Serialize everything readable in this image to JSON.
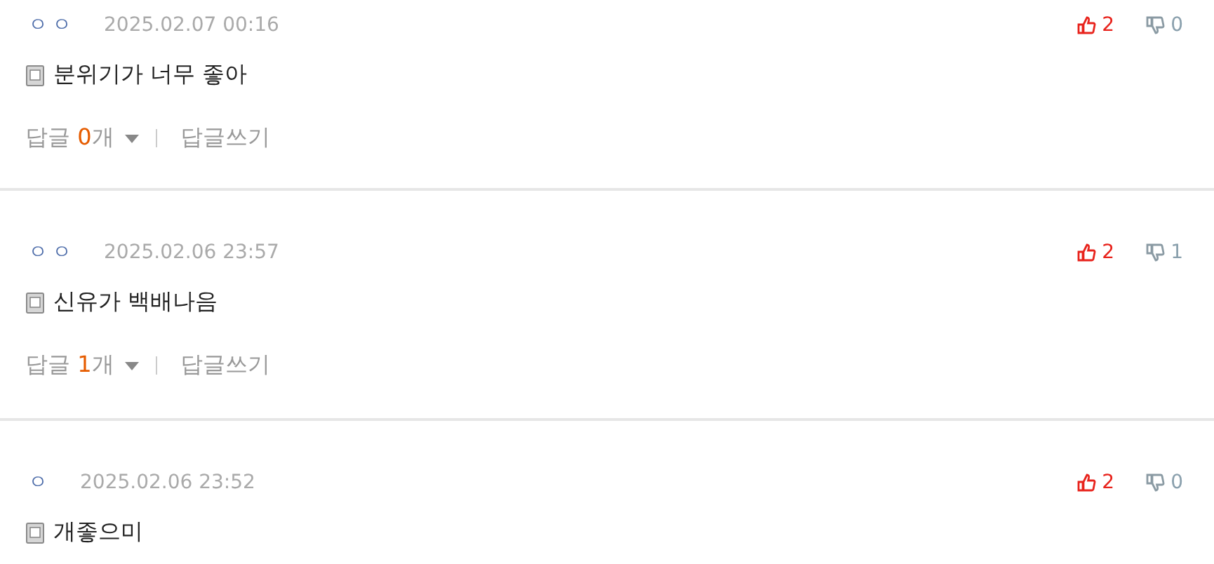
{
  "comments": [
    {
      "author": "ㅇㅇ",
      "date": "2025.02.07 00:16",
      "likes": "2",
      "dislikes": "0",
      "text": "분위기가 너무 좋아",
      "replies": {
        "label": "답글",
        "count": "0",
        "unit": "개",
        "write": "답글쓰기"
      }
    },
    {
      "author": "ㅇㅇ",
      "date": "2025.02.06 23:57",
      "likes": "2",
      "dislikes": "1",
      "text": "신유가 백배나음",
      "replies": {
        "label": "답글",
        "count": "1",
        "unit": "개",
        "write": "답글쓰기"
      }
    },
    {
      "author": "ㅇ",
      "date": "2025.02.06 23:52",
      "likes": "2",
      "dislikes": "0",
      "text": "개좋으미"
    }
  ]
}
